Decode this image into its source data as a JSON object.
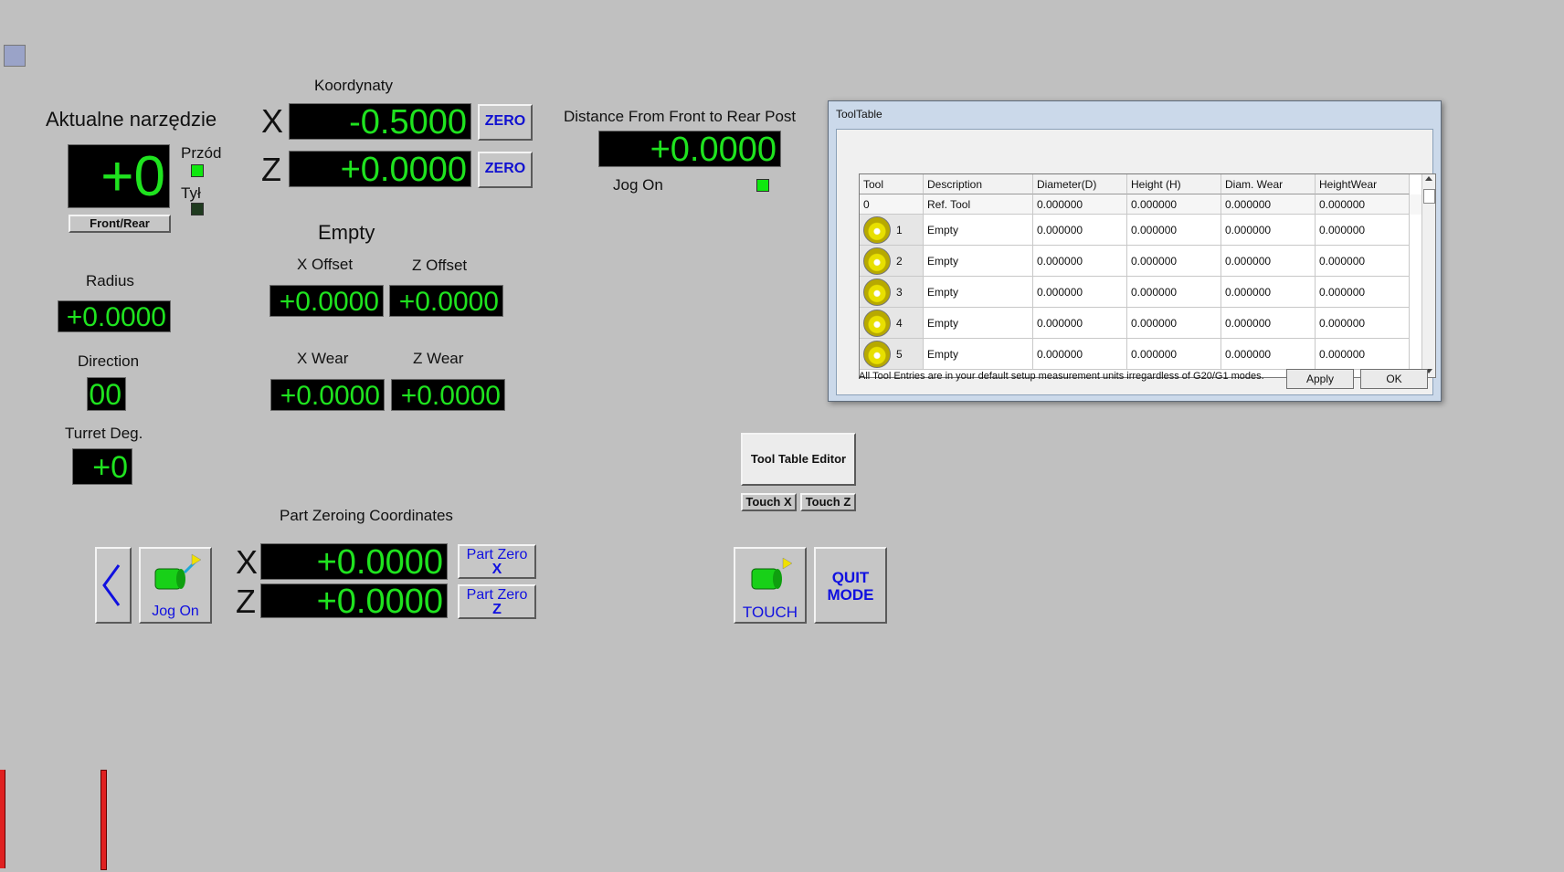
{
  "labels": {
    "current_tool": "Aktualne narzędzie",
    "coords": "Koordynaty",
    "front": "Przód",
    "rear": "Tył",
    "distance": "Distance From Front to Rear Post",
    "jog_on": "Jog On",
    "tool_desc": "Empty",
    "x_offset": "X Offset",
    "z_offset": "Z Offset",
    "x_wear": "X Wear",
    "z_wear": "Z Wear",
    "radius": "Radius",
    "direction": "Direction",
    "turret_deg": "Turret Deg.",
    "part_zeroing": "Part Zeroing Coordinates",
    "axis_x": "X",
    "axis_z": "Z"
  },
  "values": {
    "tool_number": "+0",
    "x_coord": "-0.5000",
    "z_coord": "+0.0000",
    "distance": "+0.0000",
    "x_offset": "+0.0000",
    "z_offset": "+0.0000",
    "x_wear": "+0.0000",
    "z_wear": "+0.0000",
    "radius": "+0.0000",
    "direction": "00",
    "turret_deg": "+0",
    "part_x": "+0.0000",
    "part_z": "+0.0000"
  },
  "leds": {
    "front": "on",
    "rear": "off",
    "jog": "on"
  },
  "buttons": {
    "front_rear": "Front/Rear",
    "zero": "ZERO",
    "tool_table_editor": "Tool Table Editor",
    "touch_x": "Touch X",
    "touch_z": "Touch Z",
    "jog_on": "Jog On",
    "part_zero": "Part Zero",
    "touch": "TOUCH",
    "quit_line1": "QUIT",
    "quit_line2": "MODE"
  },
  "tool_table": {
    "title": "ToolTable",
    "columns": [
      "Tool",
      "Description",
      "Diameter(D)",
      "Height (H)",
      "Diam. Wear",
      "HeightWear"
    ],
    "ref_row": [
      "0",
      "Ref. Tool",
      "0.000000",
      "0.000000",
      "0.000000",
      "0.000000"
    ],
    "rows": [
      [
        "1",
        "Empty",
        "0.000000",
        "0.000000",
        "0.000000",
        "0.000000"
      ],
      [
        "2",
        "Empty",
        "0.000000",
        "0.000000",
        "0.000000",
        "0.000000"
      ],
      [
        "3",
        "Empty",
        "0.000000",
        "0.000000",
        "0.000000",
        "0.000000"
      ],
      [
        "4",
        "Empty",
        "0.000000",
        "0.000000",
        "0.000000",
        "0.000000"
      ],
      [
        "5",
        "Empty",
        "0.000000",
        "0.000000",
        "0.000000",
        "0.000000"
      ]
    ],
    "footnote": "All Tool Entries are in your default setup measurement units irregardless of G20/G1 modes.",
    "apply": "Apply",
    "ok": "OK"
  },
  "colors": {
    "dro_text": "#1fe31f",
    "led_on": "#0fe80f",
    "accent_blue": "#1010e0",
    "bar_red": "#e02020"
  }
}
